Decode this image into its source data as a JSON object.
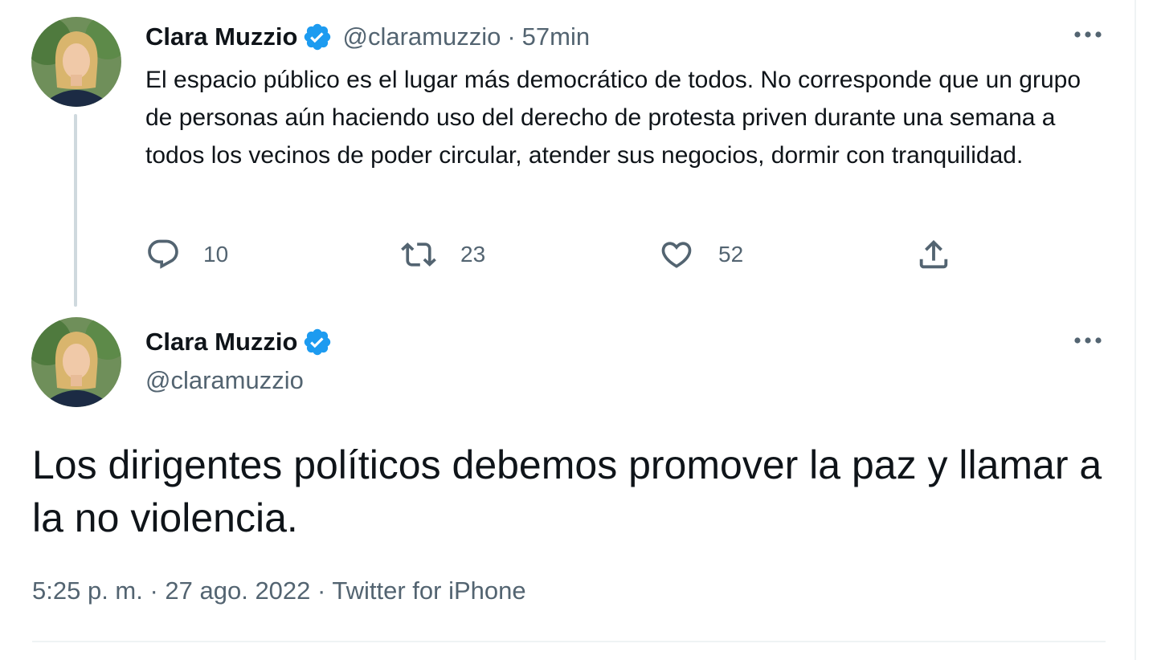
{
  "colors": {
    "verified_blue": "#1d9bf0",
    "secondary_text": "#536471",
    "primary_text": "#0f1419",
    "thread_line": "#cfd9de"
  },
  "reply_tweet": {
    "author_name": "Clara Muzzio",
    "handle": "@claramuzzio",
    "separator": "·",
    "time": "57min",
    "text": "El espacio público es el lugar más democrático de todos. No corresponde que un grupo de personas aún haciendo uso del derecho de protesta priven durante una semana a todos los vecinos de poder circular, atender sus negocios, dormir con tranquilidad.",
    "actions": {
      "reply_icon": "reply-icon",
      "reply_count": "10",
      "retweet_icon": "retweet-icon",
      "retweet_count": "23",
      "like_icon": "heart-icon",
      "like_count": "52",
      "share_icon": "share-icon"
    },
    "more_icon": "more-dots-icon"
  },
  "main_tweet": {
    "author_name": "Clara Muzzio",
    "handle": "@claramuzzio",
    "text": "Los dirigentes políticos debemos promover la paz y llamar a la no violencia.",
    "timestamp": "5:25 p. m. · 27 ago. 2022 · Twitter for iPhone",
    "more_icon": "more-dots-icon"
  }
}
